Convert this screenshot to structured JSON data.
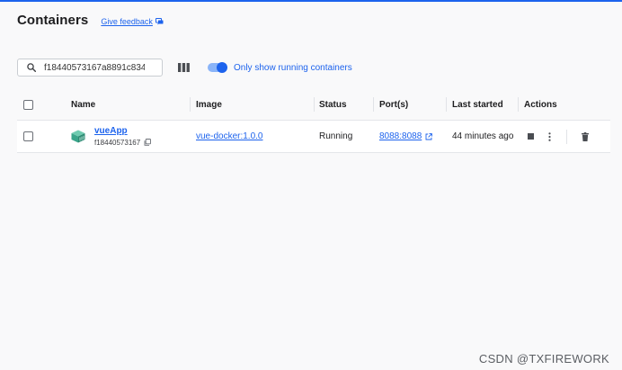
{
  "header": {
    "title": "Containers",
    "feedback_label": "Give feedback"
  },
  "toolbar": {
    "search_value": "f18440573167a8891c834",
    "toggle_on": true,
    "toggle_label": "Only show running containers"
  },
  "table": {
    "columns": [
      "Name",
      "Image",
      "Status",
      "Port(s)",
      "Last started",
      "Actions"
    ],
    "rows": [
      {
        "name": "vueApp",
        "id": "f18440573167",
        "image": "vue-docker:1.0.0",
        "status": "Running",
        "ports": "8088:8088",
        "last_started": "44 minutes ago"
      }
    ]
  },
  "colors": {
    "accent": "#1d63ed",
    "container_icon": "#3aa58a"
  },
  "watermark": "CSDN @TXFIREWORK"
}
